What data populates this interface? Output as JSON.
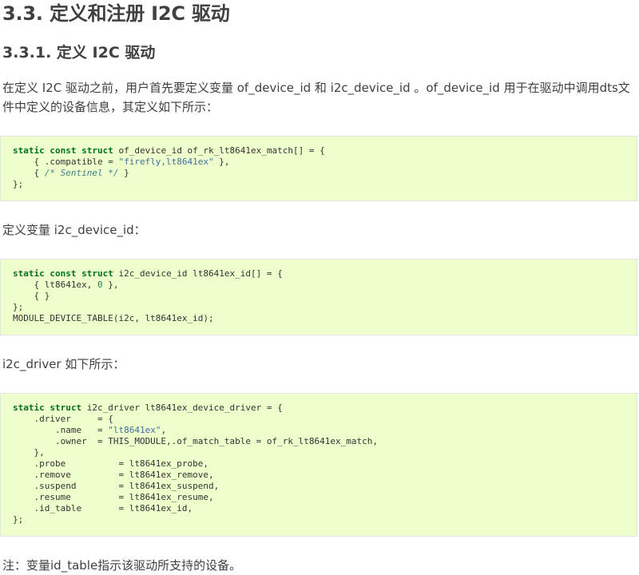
{
  "section": {
    "title": "3.3. 定义和注册 I2C 驱动",
    "subtitle": "3.3.1. 定义 I2C 驱动"
  },
  "paragraphs": {
    "intro": "在定义 I2C 驱动之前，用户首先要定义变量 of_device_id 和 i2c_device_id 。of_device_id 用于在驱动中调用dts文件中定义的设备信息，其定义如下所示：",
    "device_id": "定义变量 i2c_device_id：",
    "driver": "i2c_driver 如下所示：",
    "note": "注：变量id_table指示该驱动所支持的设备。"
  },
  "code_blocks": {
    "of_match": {
      "l1_kw": "static const struct",
      "l1_rest": " of_device_id of_rk_lt8641ex_match[] = {",
      "l2_pre": "    { .compatible = ",
      "l2_str": "\"firefly,lt8641ex\"",
      "l2_post": " },",
      "l3_pre": "    { ",
      "l3_cm": "/* Sentinel */",
      "l3_post": " }",
      "l4": "};"
    },
    "i2c_id": {
      "l1_kw": "static const struct",
      "l1_rest": " i2c_device_id lt8641ex_id[] = {",
      "l2_pre": "    { lt8641ex, ",
      "l2_num": "0",
      "l2_post": " },",
      "l3": "    { }",
      "l4": "};",
      "l5": "MODULE_DEVICE_TABLE(i2c, lt8641ex_id);"
    },
    "driver": {
      "l1_kw": "static struct",
      "l1_rest": " i2c_driver lt8641ex_device_driver = {",
      "l2": "    .driver     = {",
      "l3_pre": "        .name   = ",
      "l3_str": "\"lt8641ex\"",
      "l3_post": ",",
      "l4": "        .owner  = THIS_MODULE,.of_match_table = of_rk_lt8641ex_match,",
      "l5": "    },",
      "l6": "    .probe          = lt8641ex_probe,",
      "l7": "    .remove         = lt8641ex_remove,",
      "l8": "    .suspend        = lt8641ex_suspend,",
      "l9": "    .resume         = lt8641ex_resume,",
      "l10": "    .id_table       = lt8641ex_id,",
      "l11": "};"
    }
  },
  "colors": {
    "code_background": "#eeffcc",
    "keyword": "#007020",
    "string": "#4070a0",
    "comment": "#408090",
    "text": "#404040"
  }
}
